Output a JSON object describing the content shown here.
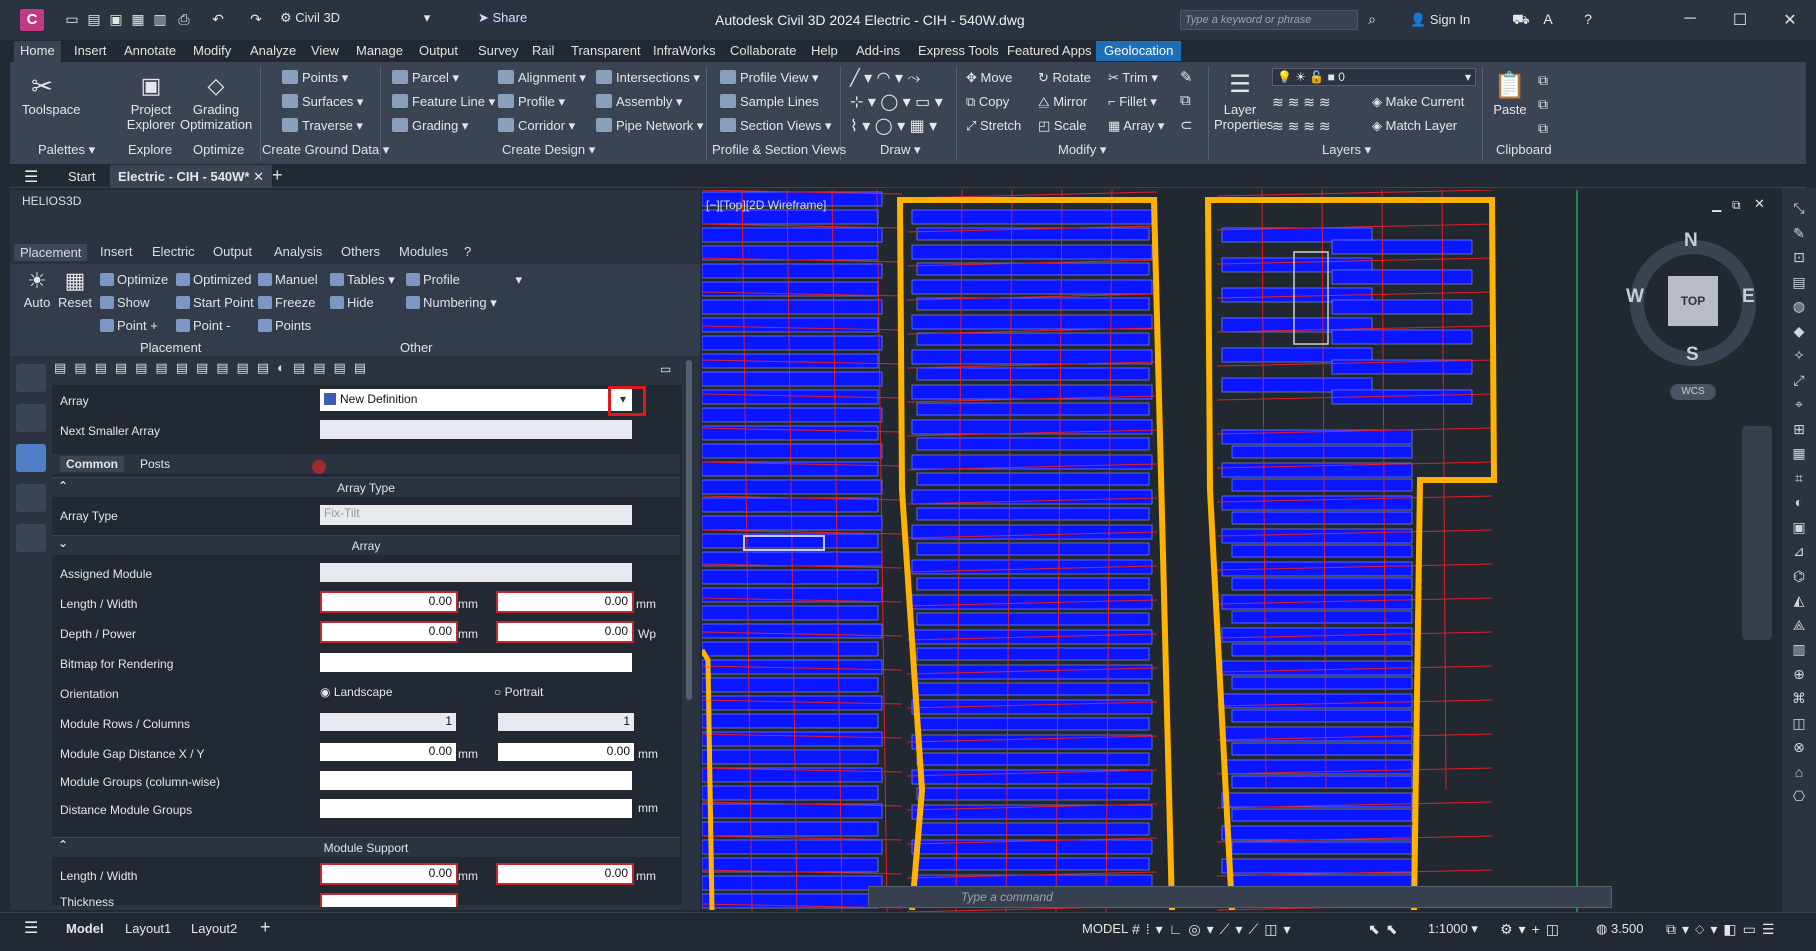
{
  "titlebar": {
    "workspace": "Civil 3D",
    "share": "Share",
    "title": "Autodesk Civil 3D 2024   Electric - CIH - 540W.dwg",
    "search_placeholder": "Type a keyword or phrase",
    "signin": "Sign In"
  },
  "menu_tabs": [
    "Home",
    "Insert",
    "Annotate",
    "Modify",
    "Analyze",
    "View",
    "Manage",
    "Output",
    "Survey",
    "Rail",
    "Transparent",
    "InfraWorks",
    "Collaborate",
    "Help",
    "Add-ins",
    "Express Tools",
    "Featured Apps",
    "Geolocation"
  ],
  "ribbon": {
    "toolspace": "Toolspace",
    "project_explorer": "Project Explorer",
    "grading_optimization": "Grading Optimization",
    "points": "Points",
    "surfaces": "Surfaces",
    "traverse": "Traverse",
    "parcel": "Parcel",
    "feature_line": "Feature Line",
    "grading": "Grading",
    "alignment": "Alignment",
    "profile": "Profile",
    "corridor": "Corridor",
    "intersections": "Intersections",
    "assembly": "Assembly",
    "pipe_network": "Pipe Network",
    "profile_view": "Profile View",
    "sample_lines": "Sample Lines",
    "section_views": "Section Views",
    "move": "Move",
    "copy": "Copy",
    "stretch": "Stretch",
    "rotate": "Rotate",
    "mirror": "Mirror",
    "scale": "Scale",
    "trim": "Trim",
    "fillet": "Fillet",
    "array": "Array",
    "layer_properties": "Layer Properties",
    "layer_value": "0",
    "make_current": "Make Current",
    "match_layer": "Match Layer",
    "paste": "Paste",
    "panels": [
      "Palettes",
      "Explore",
      "Optimize",
      "Create Ground Data",
      "Create Design",
      "Profile & Section Views",
      "Draw",
      "Modify",
      "Layers",
      "Clipboard"
    ]
  },
  "doc_tabs": {
    "start": "Start",
    "active": "Electric - CIH - 540W*"
  },
  "palette": {
    "title": "HELIOS3D",
    "tabs": [
      "Placement",
      "Insert",
      "Electric",
      "Output",
      "Analysis",
      "Others",
      "Modules",
      "?"
    ],
    "tools": {
      "auto": "Auto",
      "reset": "Reset",
      "optimize": "Optimize",
      "optimized": "Optimized",
      "manuel": "Manuel",
      "show": "Show",
      "start_point": "Start Point",
      "freeze": "Freeze",
      "point_plus": "Point +",
      "point_minus": "Point -",
      "points": "Points",
      "tables": "Tables",
      "profile": "Profile",
      "hide": "Hide",
      "numbering": "Numbering",
      "group_placement": "Placement",
      "group_other": "Other"
    },
    "array_label": "Array",
    "array_value": "New Definition",
    "next_smaller_array": "Next Smaller Array",
    "subtabs": [
      "Common",
      "Posts"
    ],
    "section_array_type": "Array Type",
    "array_type_label": "Array Type",
    "array_type_value": "Fix-Tilt",
    "section_array": "Array",
    "assigned_module": "Assigned Module",
    "length_width": "Length / Width",
    "depth_power": "Depth / Power",
    "bitmap": "Bitmap for Rendering",
    "orientation": "Orientation",
    "landscape": "Landscape",
    "portrait": "Portrait",
    "rows_columns": "Module Rows / Columns",
    "gap": "Module Gap Distance X / Y",
    "groups": "Module Groups (column-wise)",
    "distance_groups": "Distance Module Groups",
    "section_support": "Module Support",
    "support_length_width": "Length / Width",
    "thickness": "Thickness",
    "zero": "0.00",
    "one": "1",
    "mm": "mm",
    "wp": "Wp"
  },
  "viewport": {
    "label": "[−][Top][2D Wireframe]",
    "compass": {
      "n": "N",
      "s": "S",
      "e": "E",
      "w": "W",
      "top": "TOP",
      "wcs": "WCS"
    }
  },
  "command": {
    "placeholder": "Type a command"
  },
  "status": {
    "model": "Model",
    "layout1": "Layout1",
    "layout2": "Layout2",
    "model_btn": "MODEL",
    "scale": "1:1000",
    "value": "3.500"
  },
  "colors": {
    "accent": "#1f6fb6",
    "module": "#0a16ff",
    "boundary": "#ffb300",
    "grid": "#e0202a",
    "highlight": "#e01818"
  }
}
